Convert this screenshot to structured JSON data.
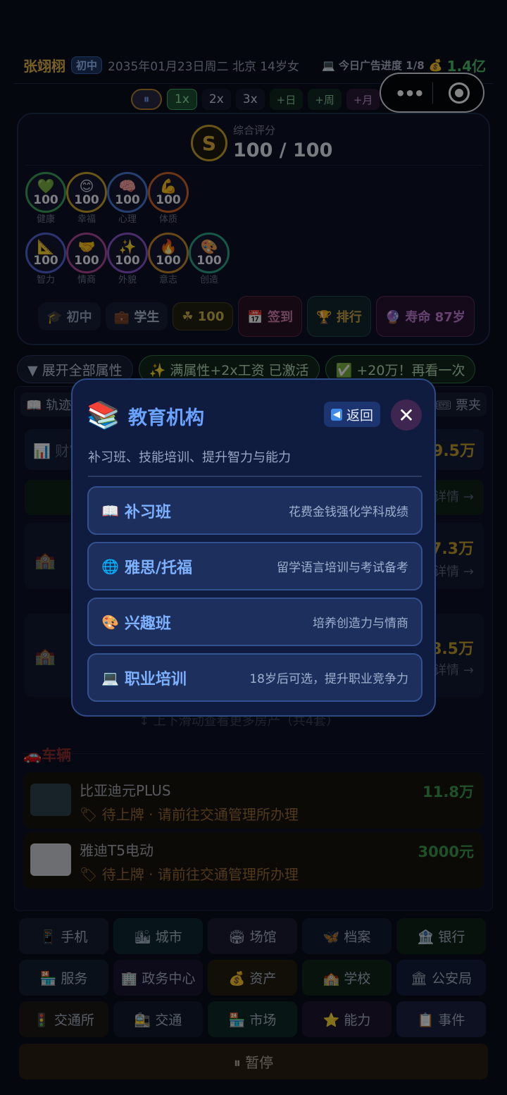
{
  "header": {
    "name": "张翊栩",
    "grade": "初中",
    "date": "2035年01月23日周二 北京 14岁女",
    "ad_progress": "💻 今日广告进度 1/8",
    "money_icon": "💰",
    "money": "1.4亿"
  },
  "speed": {
    "pause": "⏸",
    "x1": "1x",
    "x2": "2x",
    "x3": "3x",
    "day": "+日",
    "week": "+周",
    "month": "+月"
  },
  "score": {
    "badge": "S",
    "label": "综合评分",
    "value": "100 / 100"
  },
  "stats_row1": [
    {
      "emoji": "💚",
      "value": "100",
      "label": "健康",
      "color": "#3aa65a"
    },
    {
      "emoji": "😊",
      "value": "100",
      "label": "幸福",
      "color": "#c9a42b"
    },
    {
      "emoji": "🧠",
      "value": "100",
      "label": "心理",
      "color": "#4a7ad8"
    },
    {
      "emoji": "💪",
      "value": "100",
      "label": "体质",
      "color": "#d0662b"
    }
  ],
  "stats_row2": [
    {
      "emoji": "📐",
      "value": "100",
      "label": "智力",
      "color": "#5566d8"
    },
    {
      "emoji": "🤝",
      "value": "100",
      "label": "情商",
      "color": "#b04a9a"
    },
    {
      "emoji": "✨",
      "value": "100",
      "label": "外貌",
      "color": "#8c55cc"
    },
    {
      "emoji": "🔥",
      "value": "100",
      "label": "意志",
      "color": "#c88a2b"
    },
    {
      "emoji": "🎨",
      "value": "100",
      "label": "创造",
      "color": "#2ba88a"
    }
  ],
  "chips": {
    "school": "🎓 初中",
    "role": "💼 学生",
    "luck": "☘ 100",
    "signin": "📅 签到",
    "rank": "🏆 排行",
    "life": "🔮 寿命 87岁"
  },
  "expand": {
    "toggle": "▼ 展开全部属性",
    "bonus": "✨ 满属性+2x工资 已激活",
    "reward": "✅ +20万！再看一次"
  },
  "background": {
    "tab_left": "📖 轨迹",
    "tab_right": "🎟 票夹",
    "finance": "📊 财富",
    "finance_value": "9.5万",
    "prop_value_1": "7.3万",
    "prop_value_2": "8.5万",
    "detail": "详情 →",
    "scroll_hint": "↕ 上下滑动查看更多房产（共4套）",
    "vehicles_title": "🚗车辆",
    "vehicles": [
      {
        "name": "比亚迪元PLUS",
        "price": "11.8万",
        "tag": "🏷 待上牌 · 请前往交通管理所办理"
      },
      {
        "name": "雅迪T5电动",
        "price": "3000元",
        "tag": "🏷 待上牌 · 请前往交通管理所办理"
      }
    ]
  },
  "bottom_nav": [
    {
      "label": "📱 手机",
      "bg": "#151d33"
    },
    {
      "label": "🏙 城市",
      "bg": "#0f2a33"
    },
    {
      "label": "🏟 场馆",
      "bg": "#1a1c33"
    },
    {
      "label": "🦋 档案",
      "bg": "#131d33"
    },
    {
      "label": "🏦 银行",
      "bg": "#102418"
    },
    {
      "label": "🏪 服务",
      "bg": "#121f33"
    },
    {
      "label": "🏢 政务中心",
      "bg": "#1a1530"
    },
    {
      "label": "💰 资产",
      "bg": "#231b10"
    },
    {
      "label": "🏫 学校",
      "bg": "#11261a"
    },
    {
      "label": "🏛 公安局",
      "bg": "#131d3a"
    },
    {
      "label": "🚦 交通所",
      "bg": "#1c1a16"
    },
    {
      "label": "🚉 交通",
      "bg": "#10192e"
    },
    {
      "label": "🏪 市场",
      "bg": "#0f2a2a"
    },
    {
      "label": "⭐ 能力",
      "bg": "#1f1630"
    },
    {
      "label": "📋 事件",
      "bg": "#1a2240"
    }
  ],
  "pause_bar": "⏸ 暂停",
  "modal": {
    "icon": "📚",
    "title": "教育机构",
    "back": "返回",
    "back_icon": "◀",
    "close": "✕",
    "subtitle": "补习班、技能培训、提升智力与能力",
    "options": [
      {
        "icon": "📖",
        "label": "补习班",
        "desc": "花费金钱强化学科成绩"
      },
      {
        "icon": "🌐",
        "label": "雅思/托福",
        "desc": "留学语言培训与考试备考"
      },
      {
        "icon": "🎨",
        "label": "兴趣班",
        "desc": "培养创造力与情商"
      },
      {
        "icon": "💻",
        "label": "职业培训",
        "desc": "18岁后可选，提升职业竞争力"
      }
    ]
  }
}
